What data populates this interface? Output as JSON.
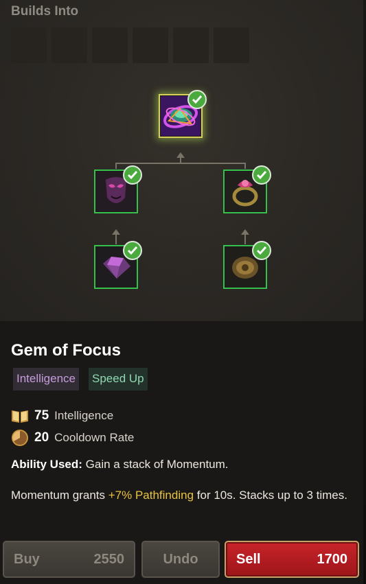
{
  "builds_into": {
    "title": "Builds Into",
    "empty_slot_count": 6
  },
  "recipe_tree": {
    "main_item": {
      "icon": "gem-of-focus-icon",
      "owned": true
    },
    "components": [
      {
        "icon": "purple-mask-icon",
        "owned": true
      },
      {
        "icon": "jeweled-ring-icon",
        "owned": true
      },
      {
        "icon": "purple-gem-icon",
        "owned": true
      },
      {
        "icon": "bronze-brooch-icon",
        "owned": true
      }
    ]
  },
  "item": {
    "name": "Gem of Focus",
    "tags": [
      "Intelligence",
      "Speed Up"
    ],
    "stats": [
      {
        "icon": "book-icon",
        "value": "75",
        "label": "Intelligence"
      },
      {
        "icon": "cooldown-icon",
        "value": "20",
        "label": "Cooldown Rate"
      }
    ],
    "ability_label": "Ability Used:",
    "ability_text": "Gain a stack of Momentum.",
    "passive_before": "Momentum grants",
    "passive_highlight": "+7% Pathfinding",
    "passive_after": "for 10s. Stacks up to 3 times."
  },
  "actions": {
    "buy_label": "Buy",
    "buy_price": "2550",
    "undo_label": "Undo",
    "sell_label": "Sell",
    "sell_price": "1700"
  },
  "colors": {
    "owned_border": "#36c04c",
    "check_fill": "#4aaa3e",
    "sell_red": "#c8242a",
    "highlight_yellow": "#e8c442",
    "tag_intelligence": "#c69ddb",
    "tag_speed": "#8fd8b2"
  }
}
